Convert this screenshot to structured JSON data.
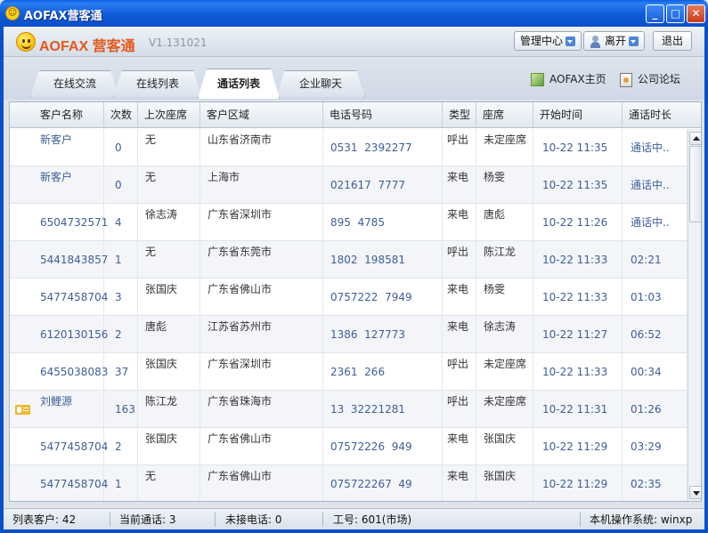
{
  "window": {
    "title": "AOFAX营客通",
    "controls": {
      "minimize": "_",
      "maximize": "□",
      "close": "✕"
    }
  },
  "header": {
    "brand_en": "AOFAX",
    "brand_cn": "营客通",
    "version": "V1.131021",
    "buttons": {
      "admin_center": "管理中心",
      "away": "离开",
      "logout": "退出"
    }
  },
  "tabs": [
    {
      "label": "在线交流",
      "active": false
    },
    {
      "label": "在线列表",
      "active": false
    },
    {
      "label": "通话列表",
      "active": true
    },
    {
      "label": "企业聊天",
      "active": false
    }
  ],
  "links": {
    "home": "AOFAX主页",
    "forum": "公司论坛"
  },
  "table": {
    "columns": [
      "客户名称",
      "次数",
      "上次座席",
      "客户区域",
      "电话号码",
      "类型",
      "座席",
      "开始时间",
      "通话时长"
    ],
    "rows": [
      {
        "name": "新客户",
        "count": "0",
        "last_agent": "无",
        "region": "山东省济南市",
        "phone": "0531  2392277",
        "type": "呼出",
        "agent": "未定座席",
        "start": "10-22 11:35",
        "duration": "通话中..",
        "vcard": false
      },
      {
        "name": "新客户",
        "count": "0",
        "last_agent": "无",
        "region": "上海市",
        "phone": "021617  7777",
        "type": "来电",
        "agent": "杨雯",
        "start": "10-22 11:35",
        "duration": "通话中..",
        "vcard": false
      },
      {
        "name": "6504732571",
        "count": "4",
        "last_agent": "徐志涛",
        "region": "广东省深圳市",
        "phone": "895  4785",
        "type": "来电",
        "agent": "唐彪",
        "start": "10-22 11:26",
        "duration": "通话中..",
        "vcard": false
      },
      {
        "name": "5441843857",
        "count": "1",
        "last_agent": "无",
        "region": "广东省东莞市",
        "phone": "1802  198581",
        "type": "呼出",
        "agent": "陈江龙",
        "start": "10-22 11:33",
        "duration": "02:21",
        "vcard": false
      },
      {
        "name": "5477458704",
        "count": "3",
        "last_agent": "张国庆",
        "region": "广东省佛山市",
        "phone": "0757222  7949",
        "type": "来电",
        "agent": "杨雯",
        "start": "10-22 11:33",
        "duration": "01:03",
        "vcard": false
      },
      {
        "name": "6120130156",
        "count": "2",
        "last_agent": "唐彪",
        "region": "江苏省苏州市",
        "phone": "1386  127773",
        "type": "来电",
        "agent": "徐志涛",
        "start": "10-22 11:27",
        "duration": "06:52",
        "vcard": false
      },
      {
        "name": "6455038083",
        "count": "37",
        "last_agent": "张国庆",
        "region": "广东省深圳市",
        "phone": "2361  266",
        "type": "呼出",
        "agent": "未定座席",
        "start": "10-22 11:33",
        "duration": "00:34",
        "vcard": false
      },
      {
        "name": "刘鲤源",
        "count": "163",
        "last_agent": "陈江龙",
        "region": "广东省珠海市",
        "phone": "13  32221281",
        "type": "呼出",
        "agent": "未定座席",
        "start": "10-22 11:31",
        "duration": "01:26",
        "vcard": true
      },
      {
        "name": "5477458704",
        "count": "2",
        "last_agent": "张国庆",
        "region": "广东省佛山市",
        "phone": "07572226  949",
        "type": "来电",
        "agent": "张国庆",
        "start": "10-22 11:29",
        "duration": "03:29",
        "vcard": false
      },
      {
        "name": "5477458704",
        "count": "1",
        "last_agent": "无",
        "region": "广东省佛山市",
        "phone": "075722267  49",
        "type": "来电",
        "agent": "张国庆",
        "start": "10-22 11:29",
        "duration": "02:35",
        "vcard": false
      }
    ]
  },
  "status": {
    "list_customers": "列表客户: 42",
    "current_calls": "当前通话: 3",
    "missed_calls": "未接电话: 0",
    "worker_id": "工号: 601(市场)",
    "os": "本机操作系统: winxp"
  },
  "colors": {
    "title_blue": "#0a4fc9",
    "brand_orange": "#e5581e",
    "number_blue": "#3e5f96"
  }
}
